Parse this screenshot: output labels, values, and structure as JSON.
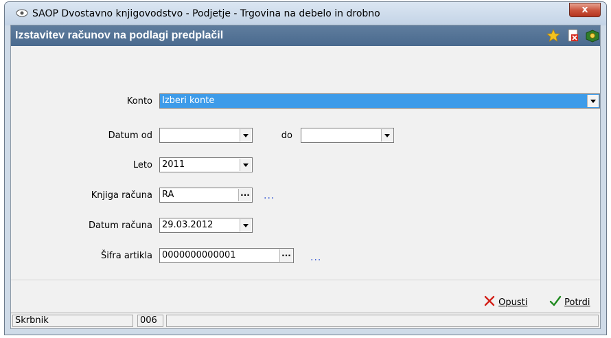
{
  "window": {
    "title": "SAOP Dvostavno knjigovodstvo - Podjetje - Trgovina na debelo in drobno",
    "close_label": "x"
  },
  "panel": {
    "title": "Izstavitev računov na podlagi predplačil"
  },
  "form": {
    "konto": {
      "label": "Konto",
      "value": "Izberi konte"
    },
    "datum_od": {
      "label": "Datum od",
      "value": ""
    },
    "datum_do": {
      "label": "do",
      "value": ""
    },
    "leto": {
      "label": "Leto",
      "value": "2011"
    },
    "knjiga_racuna": {
      "label": "Knjiga računa",
      "value": "RA",
      "browse": "...",
      "link": "..."
    },
    "datum_racuna": {
      "label": "Datum računa",
      "value": "29.03.2012"
    },
    "sifra_artikla": {
      "label": "Šifra artikla",
      "value": "0000000000001",
      "browse": "...",
      "link": "..."
    }
  },
  "actions": {
    "cancel_label": "Opusti",
    "confirm_label": "Potrdi"
  },
  "statusbar": {
    "user": "Skrbnik",
    "code": "006"
  },
  "colors": {
    "panel_header": "#4f6f93",
    "selection": "#3d9be9",
    "link_dots": "#2a4fd1",
    "cancel_icon": "#d3221a",
    "confirm_icon": "#1f8a1f"
  },
  "icons": [
    "favorite-star-icon",
    "close-document-icon",
    "help-book-icon",
    "app-icon"
  ]
}
